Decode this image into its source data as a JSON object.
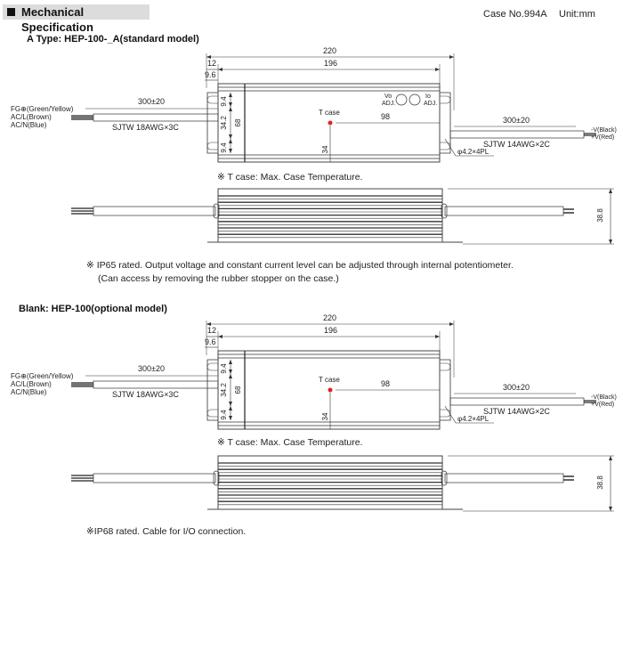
{
  "header": {
    "title": "Mechanical Specification",
    "case_no": "Case No.994A",
    "unit": "Unit:mm"
  },
  "sections": [
    {
      "title": "A Type: HEP-100-_A(standard model)",
      "top_view": {
        "overall_length": "220",
        "body_length": "196",
        "flange_offset": "12",
        "mount_offset": "9.6",
        "mount_spacing_top": "9.4",
        "mount_spacing_mid": "34.2",
        "mount_spacing_bottom": "9.4",
        "width": "68",
        "tcase_label": "T case",
        "tcase_x": "98",
        "tcase_y": "34",
        "vo_adj": [
          "Vo",
          "ADJ."
        ],
        "io_adj": [
          "Io",
          "ADJ."
        ],
        "input_cable_length": "300±20",
        "input_cable_type": "SJTW 18AWG×3C",
        "input_wires": [
          "FG⊕(Green/Yellow)",
          "AC/L(Brown)",
          "AC/N(Blue)"
        ],
        "output_cable_length": "300±20",
        "output_cable_type": "SJTW 14AWG×2C",
        "output_wires": [
          "-V(Black)",
          "+V(Red)"
        ],
        "mount_hole": "φ4.2×4PL",
        "has_adj_holes": true
      },
      "tcase_note": "※ T case: Max. Case Temperature.",
      "side_view": {
        "height": "38.8"
      },
      "notes": [
        "※ IP65 rated. Output voltage and constant current level can be adjusted through internal potentiometer.",
        "(Can access by removing the rubber stopper on the case.)"
      ]
    },
    {
      "title": "Blank: HEP-100(optional model)",
      "top_view": {
        "overall_length": "220",
        "body_length": "196",
        "flange_offset": "12",
        "mount_offset": "9.6",
        "mount_spacing_top": "9.4",
        "mount_spacing_mid": "34.2",
        "mount_spacing_bottom": "9.4",
        "width": "68",
        "tcase_label": "T case",
        "tcase_x": "98",
        "tcase_y": "34",
        "input_cable_length": "300±20",
        "input_cable_type": "SJTW 18AWG×3C",
        "input_wires": [
          "FG⊕(Green/Yellow)",
          "AC/L(Brown)",
          "AC/N(Blue)"
        ],
        "output_cable_length": "300±20",
        "output_cable_type": "SJTW 14AWG×2C",
        "output_wires": [
          "-V(Black)",
          "+V(Red)"
        ],
        "mount_hole": "φ4.2×4PL",
        "has_adj_holes": false
      },
      "tcase_note": "※ T case: Max. Case Temperature.",
      "side_view": {
        "height": "38.8"
      },
      "notes": [
        "※IP68 rated. Cable for I/O connection."
      ]
    }
  ],
  "colors": {
    "tcase_dot": "#e0202a",
    "header_bg": "#dcdcdc",
    "line": "#333333"
  }
}
